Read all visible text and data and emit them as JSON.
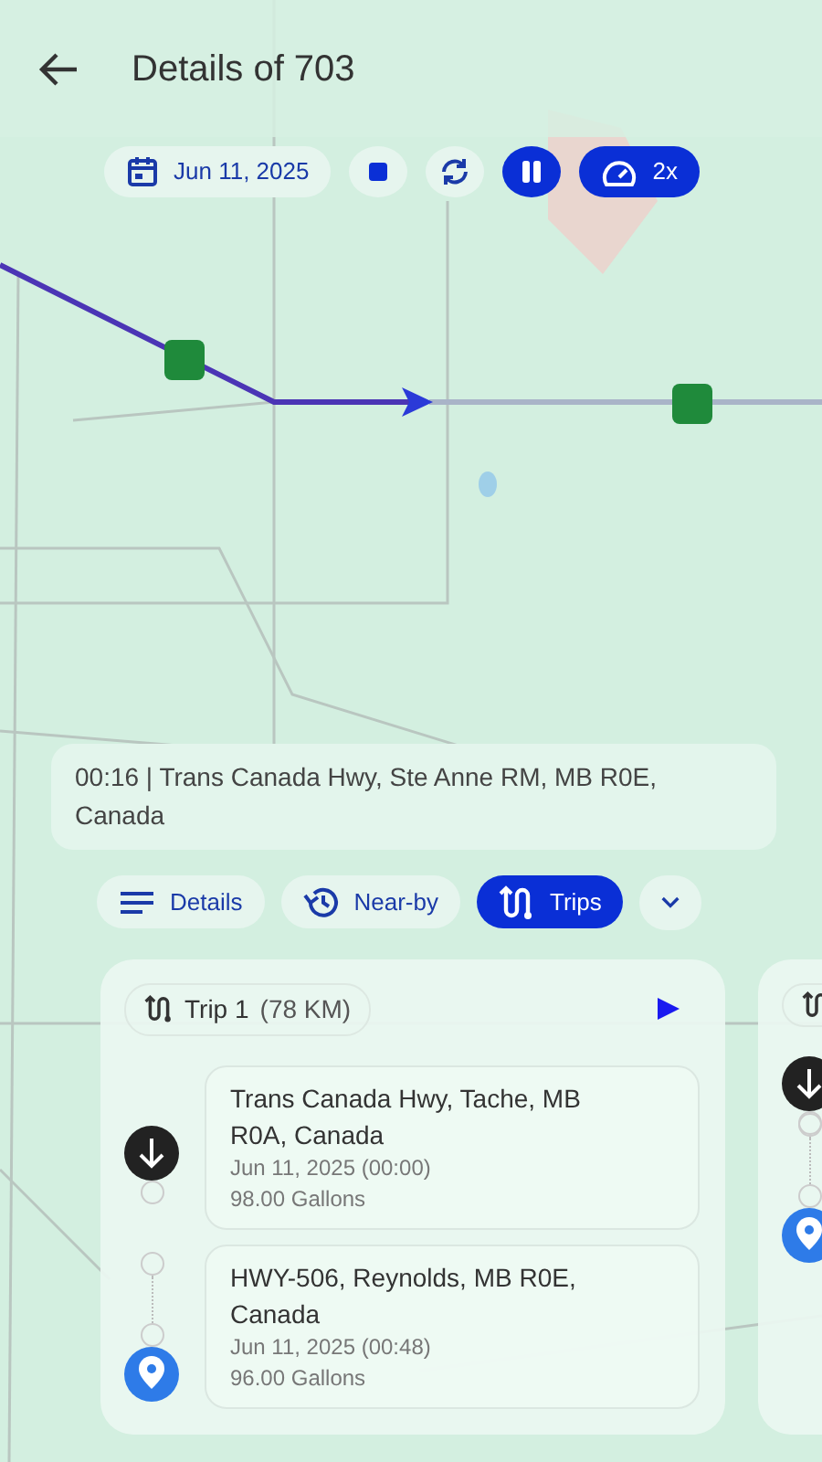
{
  "header": {
    "title": "Details of 703"
  },
  "toolbar": {
    "date": "Jun 11, 2025",
    "playing": true,
    "speed": "2x"
  },
  "location": {
    "text": "00:16 | Trans Canada Hwy, Ste Anne RM, MB R0E, Canada"
  },
  "tabs": [
    {
      "label": "Details",
      "selected": false
    },
    {
      "label": "Near-by",
      "selected": false
    },
    {
      "label": "Trips",
      "selected": true
    }
  ],
  "trips": [
    {
      "title": "Trip 1",
      "distance": "(78 KM)",
      "stops": [
        {
          "kind": "start",
          "address": "Trans Canada Hwy, Tache, MB R0A, Canada",
          "time": "Jun 11, 2025 (00:00)",
          "fuel": "98.00 Gallons"
        },
        {
          "kind": "end",
          "address": "HWY-506, Reynolds, MB R0E, Canada",
          "time": "Jun 11, 2025 (00:48)",
          "fuel": "96.00 Gallons"
        }
      ]
    },
    {
      "stops": [
        {
          "kind": "start"
        },
        {
          "kind": "end"
        }
      ]
    }
  ]
}
